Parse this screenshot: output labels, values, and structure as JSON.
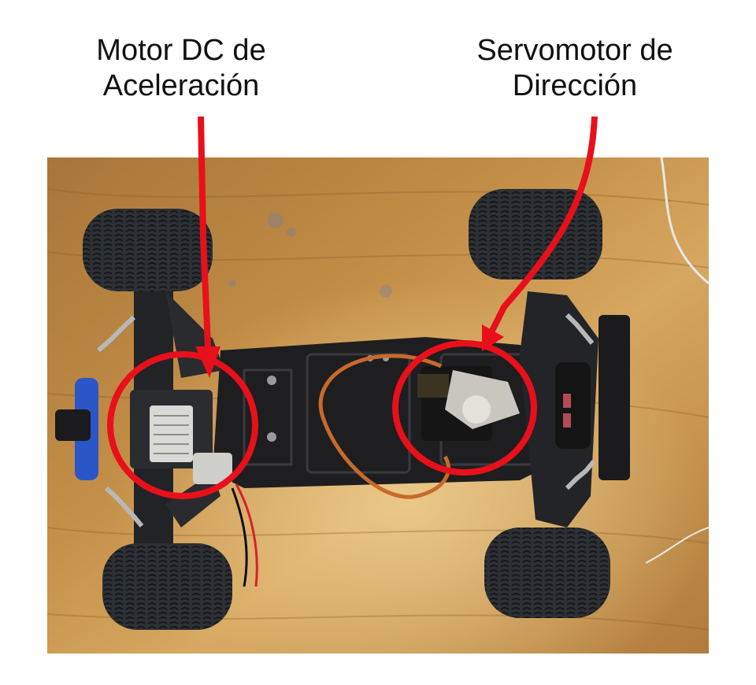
{
  "annotations": {
    "motor": {
      "line1": "Motor DC de",
      "line2": "Aceleración"
    },
    "servo": {
      "line1": "Servomotor de",
      "line2": "Dirección"
    }
  },
  "colors": {
    "marker": "#e8101a",
    "table": "#b8843f",
    "chassis": "#1e1e20",
    "tire": "#2b2d31",
    "motor_can": "#d9d9d6",
    "wire_red": "#d8202a",
    "wire_orange": "#c86a2a",
    "blue_part": "#2a56c8"
  },
  "photo": {
    "subject": "rc-car-chassis-top-view"
  }
}
